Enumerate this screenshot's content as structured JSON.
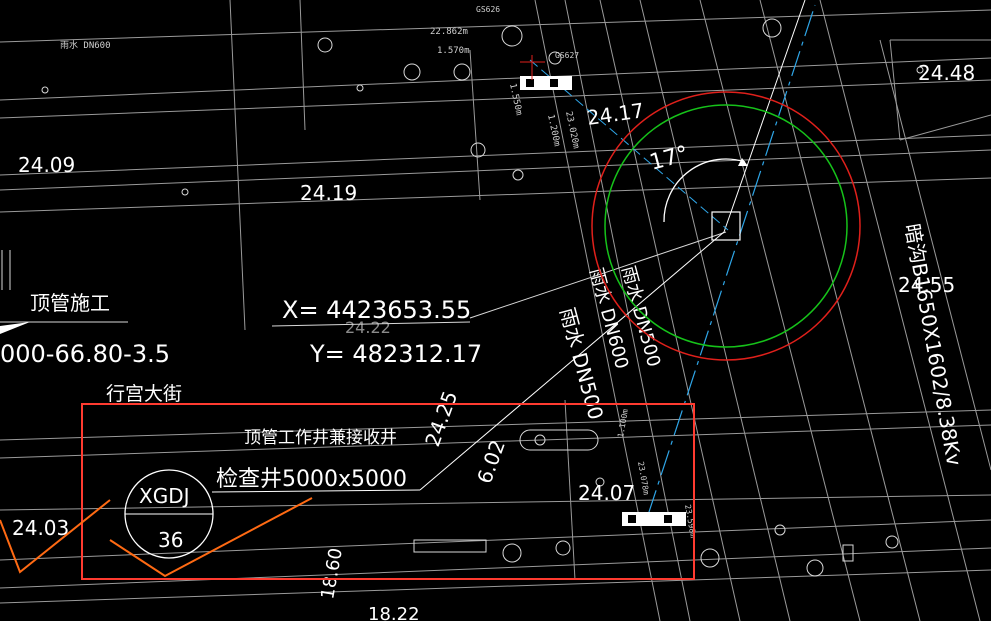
{
  "drawing": {
    "labels": {
      "jacking_construction": "顶管施工",
      "chainage": "000-66.80-3.5",
      "street_name": "行宫大街",
      "coord_x": "X= 4423653.55",
      "coord_y": "Y= 482312.17",
      "well_title": "顶管工作井兼接收井",
      "inspection_well": "检查井5000x5000",
      "well_id_top": "XGDJ",
      "well_id_bottom": "36",
      "angle": "17°",
      "pipe_spec": "暗沟B1650X1602/8.38Kv",
      "rain_pipe_top": "雨水 DN600",
      "small_dim_1": "22.862m",
      "small_dim_2": "1.570m",
      "small_dim_3": "GS626",
      "small_dim_4": "GS627",
      "small_dim_5": "1.550m",
      "small_dim_6": "1.200m",
      "small_dim_7": "23.020m",
      "small_dim_8": "1.100m",
      "small_dim_9": "23.078m",
      "small_dim_10": "23.598m",
      "elev_1": "24.09",
      "elev_2": "24.19",
      "elev_3": "24.17",
      "elev_4": "24.48",
      "elev_5": "24.55",
      "elev_6": "24.22",
      "elev_7": "24.25",
      "elev_8": "6.02",
      "elev_9": "24.07",
      "elev_10": "24.03",
      "elev_11": "18.60",
      "elev_12": "18.22",
      "pipe_label_1": "雨水 DN600",
      "pipe_label_2": "雨水 DN500",
      "pipe_label_3": "雨水 DN500"
    },
    "colors": {
      "background": "#000000",
      "highlight_box": "#ff3b30",
      "circle_outer": "#e0201b",
      "circle_inner": "#16c21a",
      "axis_line": "#2fa6e8",
      "leader": "#ffffff",
      "orange_route": "#ff6a13"
    }
  }
}
